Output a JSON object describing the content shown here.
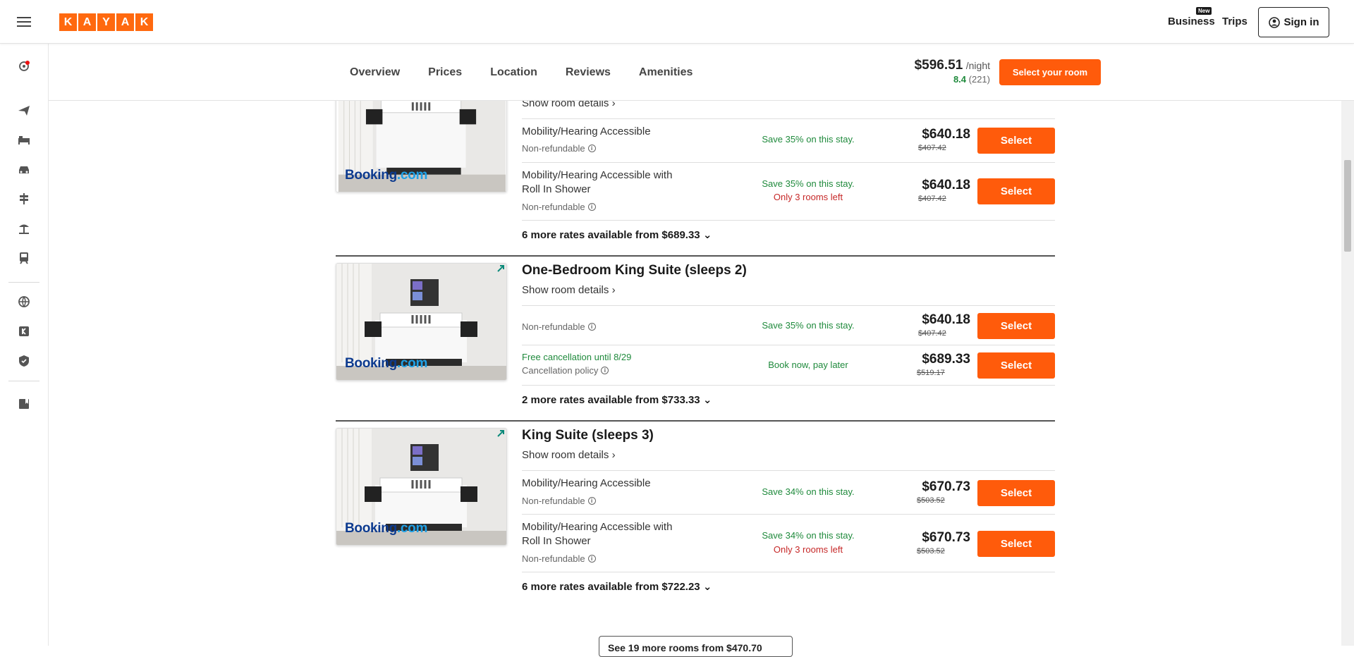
{
  "brand": {
    "logo_letters": [
      "K",
      "A",
      "Y",
      "A",
      "K"
    ],
    "accent": "#ff690f",
    "button_color": "#ff5b0b"
  },
  "header": {
    "business_label": "Business",
    "new_badge": "New",
    "trips_label": "Trips",
    "signin_label": "Sign in"
  },
  "rail_icons": [
    "notification-icon",
    "flights-icon",
    "stays-icon",
    "cars-icon",
    "packages-icon",
    "trips-beach-icon",
    "trains-icon",
    "explore-globe-icon",
    "kayak-k-icon",
    "shield-icon",
    "wishlist-icon"
  ],
  "subnav": {
    "tabs": [
      "Overview",
      "Prices",
      "Location",
      "Reviews",
      "Amenities"
    ],
    "price": "$596.51",
    "per_night": "/night",
    "rating": "8.4",
    "reviews": "(221)",
    "select_room_label": "Select your room"
  },
  "rooms": [
    {
      "title": "",
      "details_label": "Show room details",
      "provider": "Booking.com",
      "rates": [
        {
          "name": "Mobility/Hearing Accessible",
          "policy": "Non-refundable",
          "save": "Save 35% on this stay.",
          "note": "",
          "price": "$640.18",
          "old": "$407.42",
          "select": "Select"
        },
        {
          "name": "Mobility/Hearing Accessible with",
          "name2": "Roll In Shower",
          "policy": "Non-refundable",
          "save": "Save 35% on this stay.",
          "note": "Only 3 rooms left",
          "price": "$640.18",
          "old": "$407.42",
          "select": "Select"
        }
      ],
      "more": "6 more rates available from $689.33"
    },
    {
      "title": "One-Bedroom King Suite (sleeps 2)",
      "details_label": "Show room details",
      "provider": "Booking.com",
      "rates": [
        {
          "name": "",
          "policy": "Non-refundable",
          "save": "Save 35% on this stay.",
          "note": "",
          "price": "$640.18",
          "old": "$407.42",
          "select": "Select"
        },
        {
          "name": "",
          "freecxl": "Free cancellation until 8/29",
          "policy": "Cancellation policy",
          "save": "Book now, pay later",
          "note": "",
          "price": "$689.33",
          "old": "$519.17",
          "select": "Select"
        }
      ],
      "more": "2 more rates available from $733.33"
    },
    {
      "title": "King Suite (sleeps 3)",
      "details_label": "Show room details",
      "provider": "Booking.com",
      "rates": [
        {
          "name": "Mobility/Hearing Accessible",
          "policy": "Non-refundable",
          "save": "Save 34% on this stay.",
          "note": "",
          "price": "$670.73",
          "old": "$503.52",
          "select": "Select"
        },
        {
          "name": "Mobility/Hearing Accessible with",
          "name2": "Roll In Shower",
          "policy": "Non-refundable",
          "save": "Save 34% on this stay.",
          "note": "Only 3 rooms left",
          "price": "$670.73",
          "old": "$503.52",
          "select": "Select"
        }
      ],
      "more": "6 more rates available from $722.23"
    }
  ],
  "bottom_button": "See 19 more rooms from $470.70"
}
